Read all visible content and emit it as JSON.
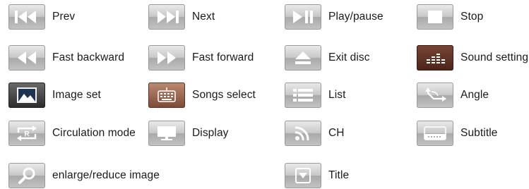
{
  "items": [
    {
      "label": "Prev",
      "icon": "prev-icon"
    },
    {
      "label": "Next",
      "icon": "next-icon"
    },
    {
      "label": "Play/pause",
      "icon": "play-pause-icon"
    },
    {
      "label": "Stop",
      "icon": "stop-icon"
    },
    {
      "label": "Fast backward",
      "icon": "fast-backward-icon"
    },
    {
      "label": "Fast forward",
      "icon": "fast-forward-icon"
    },
    {
      "label": "Exit disc",
      "icon": "eject-icon"
    },
    {
      "label": "Sound setting",
      "icon": "equalizer-icon"
    },
    {
      "label": "Image set",
      "icon": "image-icon"
    },
    {
      "label": "Songs select",
      "icon": "keyboard-icon"
    },
    {
      "label": "List",
      "icon": "list-icon"
    },
    {
      "label": "Angle",
      "icon": "angle-icon"
    },
    {
      "label": "Circulation mode",
      "icon": "repeat-icon"
    },
    {
      "label": "Display",
      "icon": "monitor-icon"
    },
    {
      "label": "CH",
      "icon": "signal-icon"
    },
    {
      "label": "Subtitle",
      "icon": "subtitle-icon"
    },
    {
      "label": "enlarge/reduce image",
      "icon": "magnifier-icon"
    },
    {
      "label": "Title",
      "icon": "title-menu-icon"
    }
  ]
}
